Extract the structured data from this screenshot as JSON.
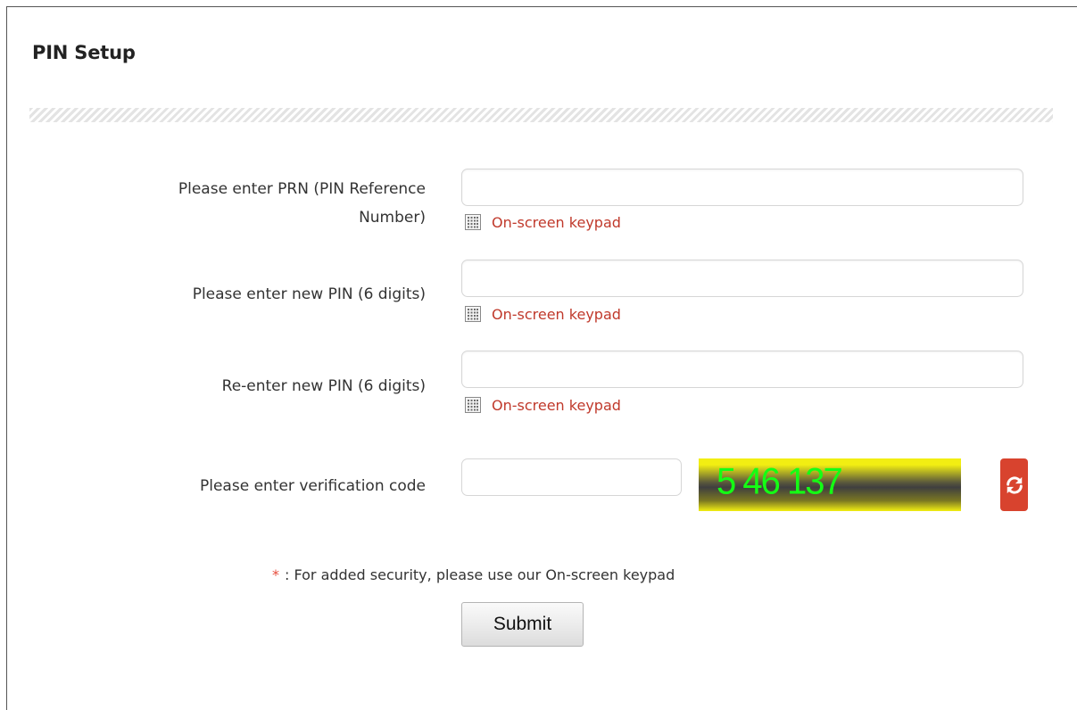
{
  "page": {
    "title": "PIN Setup"
  },
  "form": {
    "prn": {
      "label_line1": "Please enter PRN (PIN Reference",
      "label_line2": "Number)",
      "value": "",
      "keypad_label": "On-screen keypad"
    },
    "new_pin": {
      "label": "Please enter new PIN (6 digits)",
      "value": "",
      "keypad_label": "On-screen keypad"
    },
    "confirm_pin": {
      "label": "Re-enter new PIN (6 digits)",
      "value": "",
      "keypad_label": "On-screen keypad"
    },
    "verification": {
      "label": "Please enter verification code",
      "value": "",
      "captcha_text": "5 46 137",
      "refresh_icon": "refresh-icon"
    },
    "note": {
      "star": "*",
      "text": ": For added security, please use our On-screen keypad"
    },
    "submit_label": "Submit"
  },
  "colors": {
    "link": "#c0392b",
    "refresh_button": "#d8432e",
    "captcha_text": "#14ff14",
    "captcha_band": "#f2ee12"
  }
}
